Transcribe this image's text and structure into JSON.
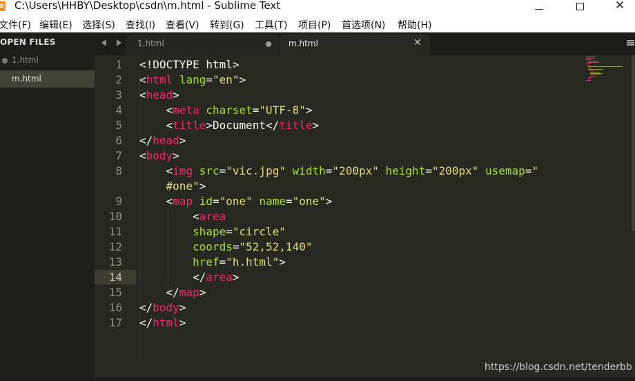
{
  "window": {
    "title": "C:\\Users\\HHBY\\Desktop\\csdn\\m.html - Sublime Text"
  },
  "menu": {
    "items": [
      "文件(F)",
      "编辑(E)",
      "选择(S)",
      "查找(I)",
      "查看(V)",
      "转到(G)",
      "工具(T)",
      "项目(P)",
      "首选项(N)",
      "帮助(H)"
    ]
  },
  "sidebar": {
    "title": "OPEN FILES",
    "files": [
      "1.html",
      "m.html"
    ]
  },
  "tabs": [
    {
      "label": "1.html",
      "modified": true
    },
    {
      "label": "m.html",
      "active": true
    }
  ],
  "editor": {
    "line_numbers": [
      "1",
      "2",
      "3",
      "4",
      "5",
      "6",
      "7",
      "8",
      "9",
      "10",
      "11",
      "12",
      "13",
      "14",
      "15",
      "16",
      "17"
    ],
    "current_line": "14",
    "code_lines": [
      "<!DOCTYPE html>",
      "<html lang=\"en\">",
      "<head>",
      "    <meta charset=\"UTF-8\">",
      "    <title>Document</title>",
      "</head>",
      "<body>",
      "    <img src=\"vic.jpg\" width=\"200px\" height=\"200px\" usemap=\"",
      "    #one\">",
      "    <map id=\"one\" name=\"one\">",
      "        <area",
      "        shape=\"circle\"",
      "        coords=\"52,52,140\"",
      "        href=\"h.html\">",
      "        </area>",
      "    </map>",
      "</body>",
      "</html>"
    ]
  },
  "theme": {
    "background": "#272822",
    "tag": "#f92672",
    "attribute": "#a6e22e",
    "string": "#e6db74",
    "text": "#f8f8f2"
  },
  "icons": [
    "app-icon",
    "minimize-icon",
    "maximize-icon",
    "close-icon",
    "arrow-left-icon",
    "arrow-right-icon",
    "dirty-dot-icon",
    "close-tab-icon",
    "hamburger-menu-icon"
  ],
  "watermark": "https://blog.csdn.net/tenderbb"
}
